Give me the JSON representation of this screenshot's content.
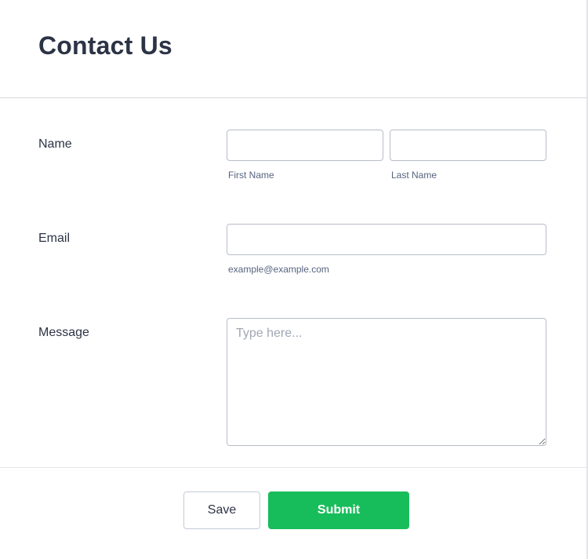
{
  "form": {
    "title": "Contact Us",
    "fields": {
      "name": {
        "label": "Name",
        "first": {
          "value": "",
          "sublabel": "First Name"
        },
        "last": {
          "value": "",
          "sublabel": "Last Name"
        }
      },
      "email": {
        "label": "Email",
        "value": "",
        "sublabel": "example@example.com"
      },
      "message": {
        "label": "Message",
        "value": "",
        "placeholder": "Type here..."
      }
    },
    "buttons": {
      "save_label": "Save",
      "submit_label": "Submit"
    },
    "colors": {
      "accent": "#18bd5b",
      "text": "#2c3345",
      "sublabel": "#57647e"
    }
  }
}
